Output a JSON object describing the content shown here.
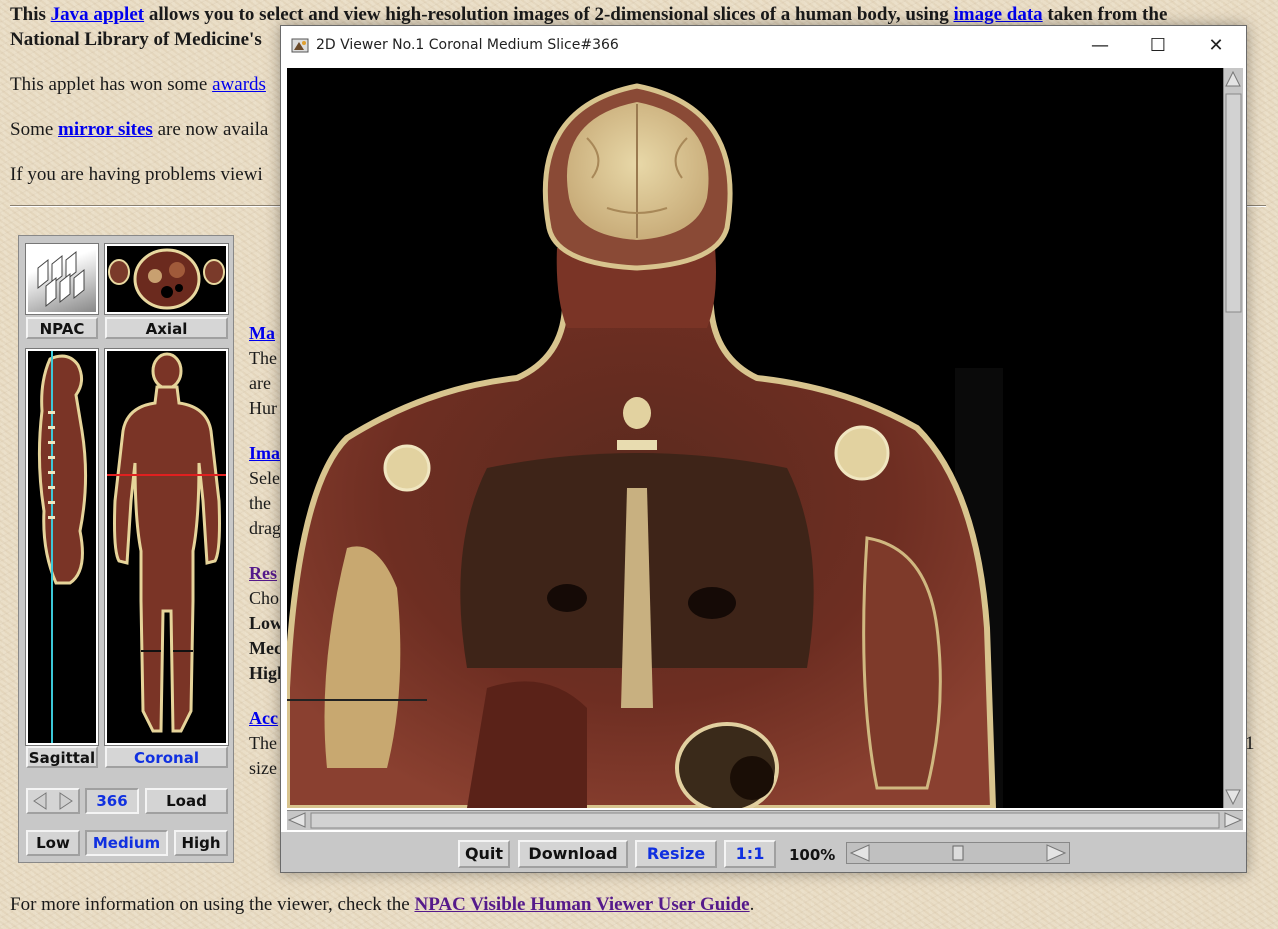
{
  "page": {
    "intro": {
      "p1_a": "This ",
      "p1_link1": "Java applet",
      "p1_b": " allows you to select and view high-resolution images of 2-dimensional slices of a human body, using ",
      "p1_link2": "image data",
      "p1_c": " taken from the",
      "p1_line2": "National Library of Medicine's",
      "p2_a": "This applet has won some ",
      "p2_link": "awards",
      "p3_a": "Some ",
      "p3_link": "mirror sites",
      "p3_b": " are now availa",
      "p4": "If you are having problems viewi"
    },
    "side_sections": [
      {
        "heading": "Ma",
        "lines": [
          "The",
          "are",
          "Hur"
        ]
      },
      {
        "heading": "Ima",
        "lines": [
          "Sele",
          "the",
          "drag"
        ]
      },
      {
        "heading": "Res",
        "lines": [
          "Cho",
          "Low",
          "Mec",
          "High"
        ]
      },
      {
        "heading": "Acc",
        "lines": [
          "The",
          "size"
        ]
      }
    ],
    "right_fragment": "1",
    "footer": {
      "text": "For more information on using the viewer, check the ",
      "link": "NPAC Visible Human Viewer User Guide",
      "end": "."
    }
  },
  "applet": {
    "views": {
      "npac": "NPAC",
      "axial": "Axial",
      "sagittal": "Sagittal",
      "coronal": "Coronal"
    },
    "active_view": "Coronal",
    "slice_number": "366",
    "load_label": "Load",
    "resolutions": {
      "low": "Low",
      "medium": "Medium",
      "high": "High"
    },
    "active_resolution": "Medium"
  },
  "viewer_window": {
    "title": "2D Viewer No.1 Coronal Medium Slice#366",
    "controls": {
      "minimize": "—",
      "maximize": "☐",
      "close": "✕"
    },
    "buttons": {
      "quit": "Quit",
      "download": "Download",
      "resize": "Resize",
      "one_to_one": "1:1"
    },
    "zoom_label": "100%"
  },
  "colors": {
    "link": "#0000ee",
    "visited": "#551a8b",
    "active_label": "#1030e0"
  }
}
